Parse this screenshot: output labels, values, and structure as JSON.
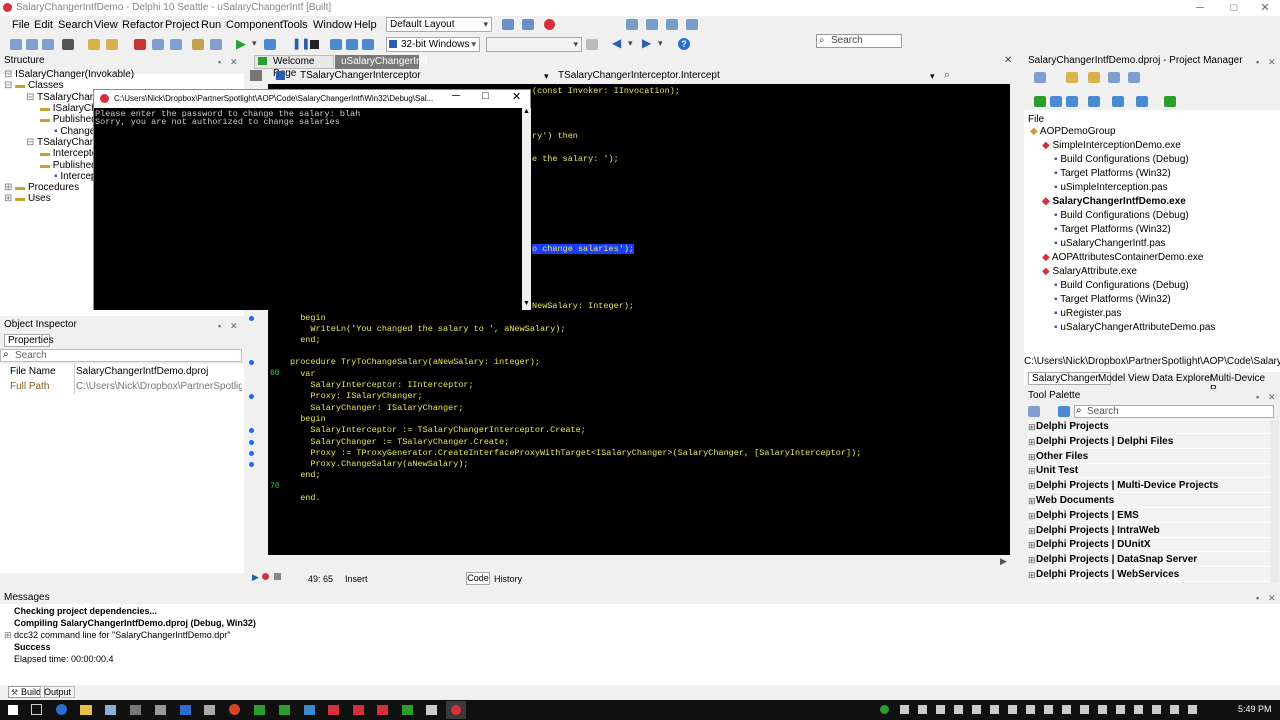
{
  "window": {
    "title": "SalaryChangerIntfDemo - Delphi 10 Seattle - uSalaryChangerIntf [Built]",
    "controls": [
      "─",
      "□",
      "✕"
    ]
  },
  "menu": {
    "items": [
      "File",
      "Edit",
      "Search",
      "View",
      "Refactor",
      "Project",
      "Run",
      "Component",
      "Tools",
      "Window",
      "Help"
    ],
    "layout": "Default Layout",
    "search_placeholder": "Search"
  },
  "toolbar": {
    "platform": "32-bit Windows"
  },
  "structure": {
    "title": "Structure",
    "tree": [
      "ISalaryChanger(Invokable)",
      "Classes",
      "TSalaryChange",
      "ISalaryCha",
      "Published",
      "Change",
      "TSalaryChang",
      "Interceptor",
      "Published",
      "Intercep",
      "Procedures",
      "Uses"
    ]
  },
  "object_inspector": {
    "title": "Object Inspector",
    "tab": "Properties",
    "search_placeholder": "Search",
    "rows": [
      {
        "name": "File Name",
        "value": "SalaryChangerIntfDemo.dproj"
      },
      {
        "name": "Full Path",
        "value": "C:\\Users\\Nick\\Dropbox\\PartnerSpotlight\\A"
      }
    ]
  },
  "editor": {
    "tabs": [
      "Welcome Page",
      "uSalaryChangerIntf"
    ],
    "class_combo": "TSalaryChangerInterceptor",
    "method_combo": "TSalaryChangerInterceptor.Intercept",
    "partial_lines": [
      "(const Invoker: IInvocation);",
      "ry') then",
      "e the salary: ');",
      "o change salaries');",
      "NewSalary: Integer);"
    ],
    "lines": [
      "  begin",
      "    WriteLn('You changed the salary to ', aNewSalary);",
      "  end;",
      "",
      "procedure TryToChangeSalary(aNewSalary: integer);",
      "  var",
      "    SalaryInterceptor: IInterceptor;",
      "    Proxy: ISalaryChanger;",
      "    SalaryChanger: ISalaryChanger;",
      "  begin",
      "    SalaryInterceptor := TSalaryChangerInterceptor.Create;",
      "    SalaryChanger := TSalaryChanger.Create;",
      "    Proxy := TProxyGenerator.CreateInterfaceProxyWithTarget<ISalaryChanger>(SalaryChanger, [SalaryInterceptor]);",
      "    Proxy.ChangeSalary(aNewSalary);",
      "  end;",
      "",
      "  end."
    ],
    "gutter_numbers": [
      "60",
      "70"
    ],
    "status_pos": "49: 65",
    "status_mode": "Insert",
    "bottom_tabs": [
      "Code",
      "History"
    ]
  },
  "console": {
    "title": "C:\\Users\\Nick\\Dropbox\\PartnerSpotlight\\AOP\\Code\\SalaryChangerIntf\\Win32\\Debug\\Sal...",
    "lines": [
      "Please enter the password to change the salary: blah",
      "Sorry, you are not authorized to change salaries"
    ]
  },
  "project_manager": {
    "title": "SalaryChangerIntfDemo.dproj - Project Manager",
    "file_label": "File",
    "items": [
      {
        "label": "AOPDemoGroup",
        "level": 0,
        "bold": false
      },
      {
        "label": "SimpleInterceptionDemo.exe",
        "level": 1,
        "bold": false
      },
      {
        "label": "Build Configurations (Debug)",
        "level": 2,
        "bold": false
      },
      {
        "label": "Target Platforms (Win32)",
        "level": 2,
        "bold": false
      },
      {
        "label": "uSimpleInterception.pas",
        "level": 2,
        "bold": false
      },
      {
        "label": "SalaryChangerIntfDemo.exe",
        "level": 1,
        "bold": true
      },
      {
        "label": "Build Configurations (Debug)",
        "level": 2,
        "bold": false
      },
      {
        "label": "Target Platforms (Win32)",
        "level": 2,
        "bold": false
      },
      {
        "label": "uSalaryChangerIntf.pas",
        "level": 2,
        "bold": false
      },
      {
        "label": "AOPAttributesContainerDemo.exe",
        "level": 1,
        "bold": false
      },
      {
        "label": "SalaryAttribute.exe",
        "level": 1,
        "bold": false
      },
      {
        "label": "Build Configurations (Debug)",
        "level": 2,
        "bold": false
      },
      {
        "label": "Target Platforms (Win32)",
        "level": 2,
        "bold": false
      },
      {
        "label": "uRegister.pas",
        "level": 2,
        "bold": false
      },
      {
        "label": "uSalaryChangerAttributeDemo.pas",
        "level": 2,
        "bold": false
      }
    ],
    "path": "C:\\Users\\Nick\\Dropbox\\PartnerSpotlight\\AOP\\Code\\SalaryChange",
    "tabs": [
      "SalaryChanger...",
      "Model View",
      "Data Explorer",
      "Multi-Device P..."
    ]
  },
  "tool_palette": {
    "title": "Tool Palette",
    "search_placeholder": "Search",
    "items": [
      "Delphi Projects",
      "Delphi Projects | Delphi Files",
      "Other Files",
      "Unit Test",
      "Delphi Projects | Multi-Device Projects",
      "Web Documents",
      "Delphi Projects | EMS",
      "Delphi Projects | IntraWeb",
      "Delphi Projects | DUnitX",
      "Delphi Projects | DataSnap Server",
      "Delphi Projects | WebServices"
    ]
  },
  "messages": {
    "title": "Messages",
    "lines": [
      "Checking project dependencies...",
      "Compiling SalaryChangerIntfDemo.dproj (Debug, Win32)",
      "dcc32 command line for \"SalaryChangerIntfDemo.dpr\"",
      "Success",
      "Elapsed time: 00:00:00.4"
    ],
    "tabs": [
      "Build",
      "Output"
    ]
  },
  "taskbar": {
    "time": "5:49 PM"
  },
  "colors": {
    "editor_bg": "#000000",
    "code_text": "#e8e85a",
    "selection": "#1a3cff",
    "tab_active": "#7a7a7a"
  }
}
